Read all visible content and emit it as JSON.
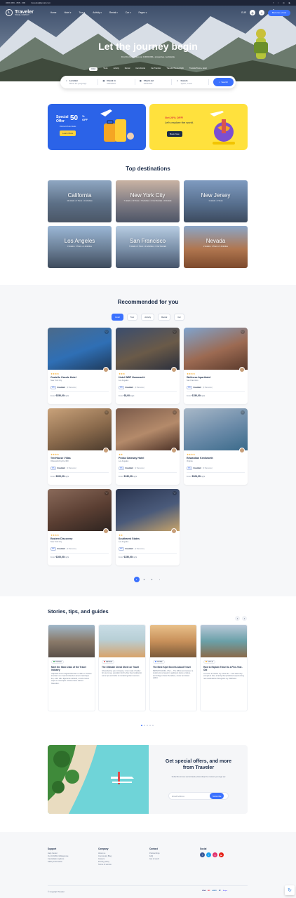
{
  "topbar": {
    "phone": "(000) 999 - 898 - 999",
    "email": "travelwp@gmail.com"
  },
  "nav": {
    "logo": "Traveler",
    "tagline": "TRAVEL COMPANY",
    "items": [
      "Home",
      "Hotel",
      "Tour",
      "Activity",
      "Rental",
      "Car",
      "Pages"
    ],
    "currency": "EUR",
    "host_btn": "Become a host"
  },
  "hero": {
    "title": "Let the journey begin",
    "subtitle": "Find the best prices on 10000,000+ properties, worldwide",
    "categories": [
      "Hotel",
      "Tours",
      "Activity",
      "Rental",
      "Cars Rental",
      "Car Transfer",
      "Transfer/Tours+Flight",
      "Transfer/Tours+ Hotel"
    ]
  },
  "search": {
    "fields": [
      {
        "label": "Location",
        "value": "Where are you going?",
        "icon": "pin-icon"
      },
      {
        "label": "Check in",
        "value": "22/03/2023",
        "icon": "calendar-icon"
      },
      {
        "label": "Check out",
        "value": "23/03/2023",
        "icon": "calendar-icon"
      },
      {
        "label": "Guests",
        "value": "1guest, 1 room",
        "icon": "user-icon"
      }
    ],
    "button": "Search"
  },
  "promo": {
    "p1": {
      "line1": "Special",
      "line2": "Offer",
      "pct": "50",
      "unit": "%",
      "off": "OFF",
      "sub": "Discount hotel deals",
      "btn": "Learn More"
    },
    "p2": {
      "line1": "Get 20% OFF!",
      "line2": "Let's explore the world.",
      "btn": "Book Now"
    }
  },
  "destinations": {
    "title": "Top destinations",
    "items": [
      {
        "name": "California",
        "meta": "12 Hotels • 4 Tours • 4 Activities"
      },
      {
        "name": "New York City",
        "meta": "7 Hotels • 10 Tours • 7 Activities • 2 Car Rentals • 2 Rentals"
      },
      {
        "name": "New Jersey",
        "meta": "1 Hotels • 2 Tours"
      },
      {
        "name": "Los Angeles",
        "meta": "3 Hotels • 5 Tours • 2 Activities"
      },
      {
        "name": "San Francisco",
        "meta": "7 Hotels • 4 Tours • 2 Activities • 1 Car Rentals"
      },
      {
        "name": "Nevada",
        "meta": "2 Hotels • 2 Tours • 3 Activities"
      }
    ]
  },
  "recommended": {
    "title": "Recommended for you",
    "tabs": [
      "Hotel",
      "Tour",
      "Activity",
      "Rental",
      "Car"
    ],
    "cards": [
      {
        "stars": "★★★★",
        "name": "Castello Casole Hotel",
        "loc": "New York City",
        "score": "5/5",
        "label": "Excellent",
        "reviews": "(3 Reviews)",
        "from": "From:",
        "price": "€350,00",
        "per": "/night"
      },
      {
        "stars": "★★★",
        "name": "Hotel WBF Hommachi",
        "loc": "Los Angeles",
        "score": "5/5",
        "label": "Excellent",
        "reviews": "(3 Reviews)",
        "from": "From:",
        "price": "€8,00",
        "per": "/night"
      },
      {
        "stars": "★★★★",
        "name": "Wellness Aparthotel",
        "loc": "San Francisco",
        "score": "5/5",
        "label": "Excellent",
        "reviews": "(3 Reviews)",
        "from": "From:",
        "price": "€150,00",
        "per": "/night"
      },
      {
        "stars": "★★★★",
        "name": "TreeHouse Villas",
        "loc": "Otherworld by the 360",
        "score": "5/5",
        "label": "Excellent",
        "reviews": "(3 Reviews)",
        "from": "From:",
        "price": "€200,00",
        "per": "/night"
      },
      {
        "stars": "★★",
        "name": "Pedas Gateway Hotel",
        "loc": "Los Angeles",
        "score": "5/5",
        "label": "Excellent",
        "reviews": "(2 Reviews)",
        "from": "From:",
        "price": "€130,00",
        "per": "/night"
      },
      {
        "stars": "★★★★",
        "name": "Edwardian Kenilworth",
        "loc": "Virginia",
        "score": "5/5",
        "label": "Excellent",
        "reviews": "(3 Reviews)",
        "from": "From:",
        "price": "€324,00",
        "per": "/night"
      },
      {
        "stars": "★★★★",
        "name": "Eastern Discovery",
        "loc": "New York City",
        "score": "5/5",
        "label": "Excellent",
        "reviews": "(3 Reviews)",
        "from": "From:",
        "price": "€100,00",
        "per": "/night"
      },
      {
        "stars": "★★",
        "name": "Southwest States",
        "loc": "Los Angeles",
        "score": "5/5",
        "label": "Excellent",
        "reviews": "(2 Reviews)",
        "from": "From:",
        "price": "€150,00",
        "per": "/night"
      }
    ],
    "pages": [
      "1",
      "2",
      "3",
      "›"
    ]
  },
  "stories": {
    "title": "Stories, tips, and guides",
    "posts": [
      {
        "tag": "TRAVEL",
        "tag_color": "#2ea44f",
        "title": "Meet the Stare Jobs of the Travel Industry",
        "excerpt": "Vulputate amet magna bibendum et nibh et. Pretium interdum non mauris bibendum amet scelerisque leo, enim odio. Eget ante eleifend, ut duis cursus turpis in consequat. Ultrices lacus ultrices bibendum."
      },
      {
        "tag": "DESIGN",
        "tag_color": "#e24a4a",
        "title": "The Ultimate Cheat Sheet on Travel",
        "excerpt": "Inbounded by your company, it can make it harder for you to see a solution for the fine lines looking for some tips and tricks to monitoring client success."
      },
      {
        "tag": "HOTEL",
        "tag_color": "#3b71fe",
        "title": "The Best Kept Secrets About Travel",
        "excerpt": "PENNSYLVANIA, USA — The difference between a tourist and a traveler is getting to know a culture, according to Karen Serafines, owner and travel addict."
      },
      {
        "tag": "STYLE",
        "tag_color": "#f5a623",
        "title": "How to Explain Travel to a Five-Year-Old",
        "excerpt": "I've been a traveler my entire life — and was lucky enough to have a family that prioritized experiencing new destinations throughout my childhood."
      }
    ]
  },
  "newsletter": {
    "title": "Get special offers, and more from Traveler",
    "sub": "Subscribe to see secret deals prices drop the moment you sign up!",
    "placeholder": "Email Address",
    "btn": "Subscribe"
  },
  "footer": {
    "cols": [
      {
        "title": "Support",
        "links": [
          "Help Center",
          "Our COVID-19 Response",
          "Cancellation options",
          "Safety information"
        ]
      },
      {
        "title": "Company",
        "links": [
          "About us",
          "Community Blog",
          "Careers",
          "Privacy policy",
          "Terms of service"
        ]
      },
      {
        "title": "Contact",
        "links": [
          "Partnerships",
          "FAQ",
          "Get in touch"
        ]
      },
      {
        "title": "Social",
        "links": []
      }
    ],
    "copyright": "© Copyright Traveler",
    "payments": [
      "VISA",
      "MC",
      "AMEX",
      "PP",
      "Stripe"
    ]
  },
  "colors": {
    "accent": "#3b71fe",
    "dark": "#1a2b48",
    "star": "#f5a623"
  }
}
